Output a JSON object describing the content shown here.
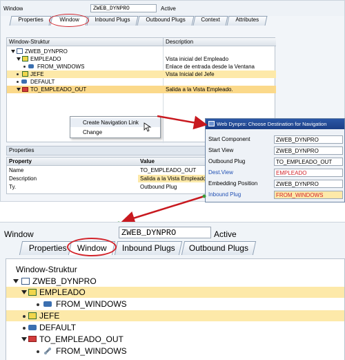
{
  "top": {
    "window_label": "Window",
    "window_value": "ZWEB_DYNPRO",
    "status": "Active",
    "tabs": [
      "Properties",
      "Window",
      "Inbound Plugs",
      "Outbound Plugs",
      "Context",
      "Attributes"
    ],
    "tree_header": "Window-Struktur",
    "desc_header": "Description",
    "tree": [
      {
        "label": "ZWEB_DYNPRO",
        "desc": ""
      },
      {
        "label": "EMPLEADO",
        "desc": "Vista inicial del Empleado"
      },
      {
        "label": "FROM_WINDOWS",
        "desc": "Enlace de entrada desde la Ventana"
      },
      {
        "label": "JEFE",
        "desc": "Vista Inicial del Jefe"
      },
      {
        "label": "DEFAULT",
        "desc": ""
      },
      {
        "label": "TO_EMPLEADO_OUT",
        "desc": "Salida a la Vista Empleado."
      }
    ],
    "context_menu": [
      "Create Navigation Link",
      "Change"
    ],
    "properties_title": "Properties",
    "props_header": {
      "col1": "Property",
      "col2": "Value"
    },
    "props": [
      {
        "name": "Name",
        "value": "TO_EMPLEADO_OUT"
      },
      {
        "name": "Description",
        "value": "Salida a la Vista Empleado."
      },
      {
        "name": "Ty.",
        "value": "Outbound Plug"
      }
    ]
  },
  "dialog": {
    "title": "Web Dynpro: Choose Destination for Navigation",
    "rows": [
      {
        "label": "Start Component",
        "value": "ZWEB_DYNPRO"
      },
      {
        "label": "Start View",
        "value": "ZWEB_DYNPRO"
      },
      {
        "label": "Outbound Plug",
        "value": "TO_EMPLEADO_OUT"
      },
      {
        "label": "Dest.View",
        "value": "EMPLEADO"
      },
      {
        "label": "Embedding Position",
        "value": "ZWEB_DYNPRO"
      },
      {
        "label": "Inbound Plug",
        "value": "FROM_WINDOWS"
      }
    ]
  },
  "bottom": {
    "window_label": "Window",
    "window_value": "ZWEB_DYNPRO",
    "status": "Active",
    "tabs": [
      "Properties",
      "Window",
      "Inbound Plugs",
      "Outbound Plugs"
    ],
    "tree_header": "Window-Struktur",
    "tree": [
      "ZWEB_DYNPRO",
      "EMPLEADO",
      "FROM_WINDOWS",
      "JEFE",
      "DEFAULT",
      "TO_EMPLEADO_OUT",
      "FROM_WINDOWS"
    ]
  },
  "colors": {
    "accent_red": "#d3242b",
    "highlight": "#fde9a9",
    "sap_blue": "#1b3f86"
  }
}
